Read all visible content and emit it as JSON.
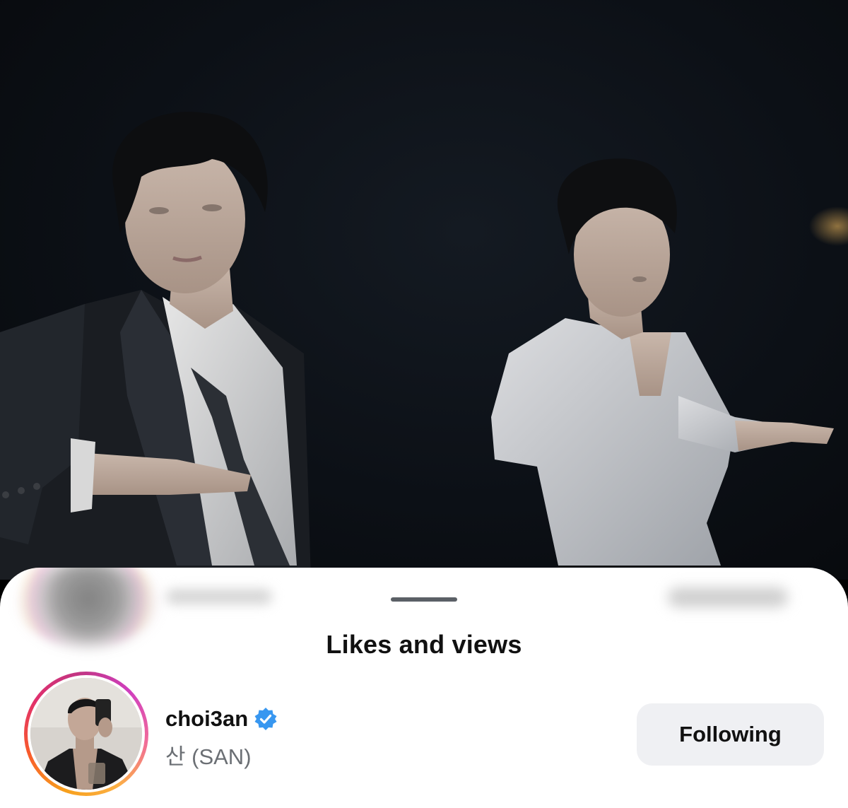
{
  "sheet": {
    "title": "Likes and views"
  },
  "user": {
    "username": "choi3an",
    "full_name": "산 (SAN)",
    "verified": true,
    "follow_button_label": "Following",
    "avatar_icon": "profile-photo-avatar",
    "verified_icon": "verified-badge-icon"
  },
  "colors": {
    "verified_blue": "#3897f0",
    "button_bg": "#eff0f3",
    "story_ring": [
      "#f7a01c",
      "#e1306c",
      "#c13584"
    ]
  }
}
